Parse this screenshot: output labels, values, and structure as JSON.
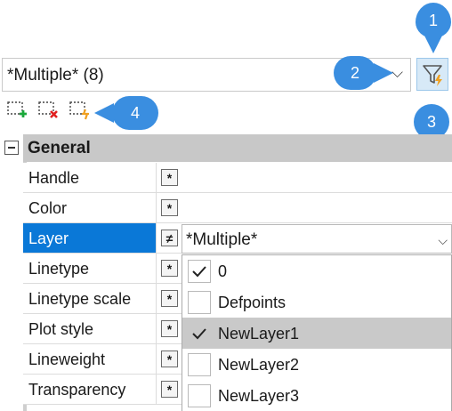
{
  "selection": {
    "value": "*Multiple* (8)"
  },
  "callouts": [
    "1",
    "2",
    "3",
    "4"
  ],
  "toolbar": [
    {
      "icon": "add-to-selection-icon"
    },
    {
      "icon": "remove-from-selection-icon"
    },
    {
      "icon": "quick-select-icon"
    }
  ],
  "category": {
    "label": "General"
  },
  "properties": [
    {
      "name": "Handle"
    },
    {
      "name": "Color"
    },
    {
      "name": "Layer",
      "value": "*Multiple*"
    },
    {
      "name": "Linetype"
    },
    {
      "name": "Linetype scale"
    },
    {
      "name": "Plot style"
    },
    {
      "name": "Lineweight"
    },
    {
      "name": "Transparency"
    }
  ],
  "symbols": {
    "varies": "*",
    "not_equal": "≠",
    "chevron": "⌵"
  },
  "layer_list": [
    {
      "name": "0",
      "checked": true
    },
    {
      "name": "Defpoints",
      "checked": false
    },
    {
      "name": "NewLayer1",
      "checked": true
    },
    {
      "name": "NewLayer2",
      "checked": false
    },
    {
      "name": "NewLayer3",
      "checked": false
    }
  ],
  "colors": {
    "accent": "#0a78d7",
    "callout": "#3a8ee0",
    "filter_bg": "#d7e9f7"
  }
}
